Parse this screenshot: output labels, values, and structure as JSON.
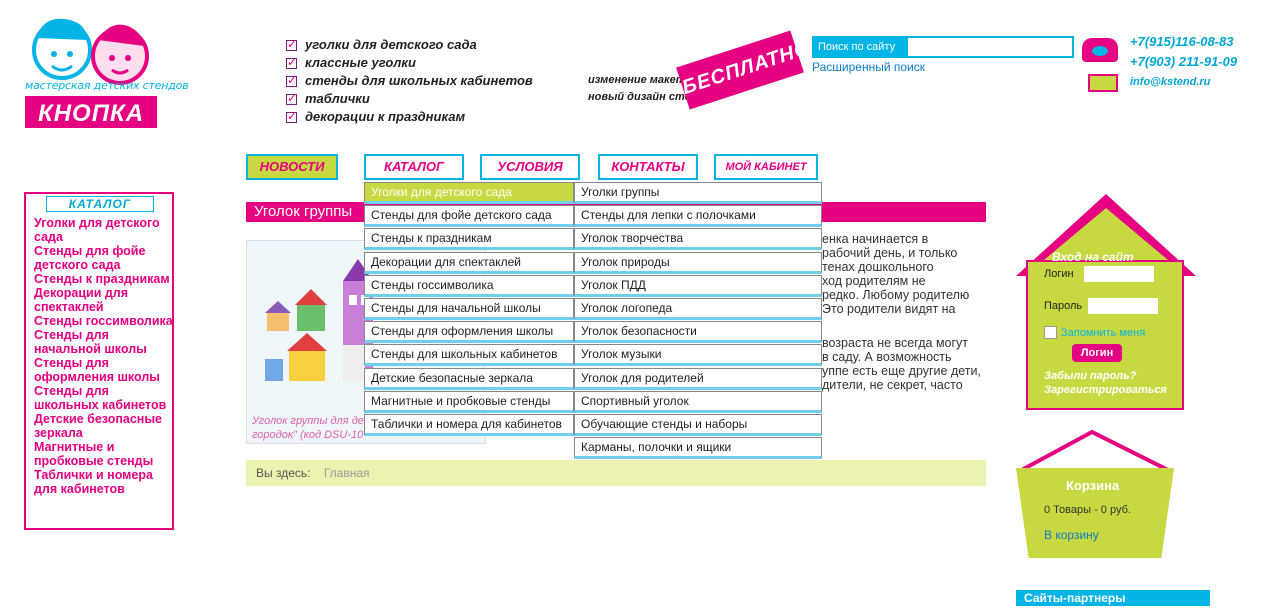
{
  "logo": {
    "subtitle": "мастерская детских стендов",
    "name": "КНОПКА"
  },
  "header_links": [
    "уголки для детского сада",
    "классные уголки",
    "стенды для школьных кабинетов",
    "таблички",
    "декорации к праздникам"
  ],
  "promo": {
    "line1": "изменение макета",
    "line2": "новый дизайн стендов",
    "stamp": "БЕСПЛАТНО"
  },
  "search": {
    "label": "Поиск по сайту",
    "value": "",
    "advanced": "Расширенный поиск"
  },
  "contacts": {
    "phone1": "+7(915)116-08-83",
    "phone2": "+7(903) 211-91-09",
    "email": "info@kstend.ru"
  },
  "nav": {
    "news": "НОВОСТИ",
    "catalog": "КАТАЛОГ",
    "terms": "УСЛОВИЯ",
    "contacts": "КОНТАКТЫ",
    "cabinet": "МОЙ КАБИНЕТ"
  },
  "sidebar": {
    "title": "КАТАЛОГ",
    "items": [
      "Уголки для детского сада",
      "Стенды для фойе детского сада",
      "Стенды к праздникам",
      "Декорации для спектаклей",
      "Стенды госсимволика",
      "Стенды для начальной школы",
      "Стенды для оформления школы",
      "Стенды для школьных кабинетов",
      "Детские безопасные зеркала",
      "Магнитные и пробковые стенды",
      "Таблички и номера для кабинетов"
    ]
  },
  "main": {
    "title": "Уголок группы",
    "caption_line1": "Уголок группы для де",
    "caption_line2": "городок\" (код DSU-10",
    "text": [
      "енка начинается в",
      "рабочий день, и только",
      "тенах дошкольного",
      "ход родителям не",
      "редко. Любому родителю",
      "Это родители видят на"
    ],
    "text2": [
      "возраста не всегда могут",
      " в саду. А возможность",
      "уппе есть еще другие дети,",
      "дители, не секрет, часто"
    ],
    "breadcrumb_label": "Вы здесь:",
    "breadcrumb_link": "Главная"
  },
  "dropdown": {
    "level1": [
      "Уголки для детского сада",
      "Стенды для фойе детского сада",
      "Стенды к праздникам",
      "Декорации для спектаклей",
      "Стенды госсимволика",
      "Стенды для начальной школы",
      "Стенды для оформления школы",
      "Стенды для школьных кабинетов",
      "Детские безопасные зеркала",
      "Магнитные и пробковые стенды",
      "Таблички и номера для кабинетов"
    ],
    "level2": [
      "Уголки группы",
      "Стенды для лепки с полочками",
      "Уголок творчества",
      "Уголок природы",
      "Уголок ПДД",
      "Уголок логопеда",
      "Уголок безопасности",
      "Уголок музыки",
      "Уголок для родителей",
      "Спортивный уголок",
      "Обучающие стенды и наборы",
      "Карманы, полочки и ящики"
    ]
  },
  "login": {
    "title": "Вход на сайт",
    "login_label": "Логин",
    "password_label": "Пароль",
    "remember": "Запомнить меня",
    "button": "Логин",
    "forgot": "Забыли пароль?",
    "register": "Зарегистрироваться"
  },
  "cart": {
    "title": "Корзина",
    "summary": "0 Товары  -  0 руб.",
    "link": "В корзину"
  },
  "partners": "Сайты-партнеры",
  "colors": {
    "pink": "#e60082",
    "cyan": "#00b4e6",
    "lime": "#c8d840"
  }
}
